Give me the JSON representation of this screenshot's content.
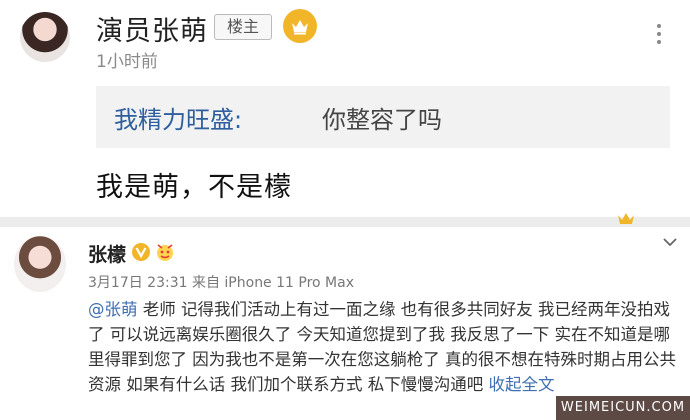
{
  "post": {
    "author": "演员张萌",
    "role_badge": "楼主",
    "time": "1小时前",
    "quote": {
      "user": "我精力旺盛:",
      "text": "你整容了吗"
    },
    "reply": "我是萌，不是檬"
  },
  "comment": {
    "author": "张檬",
    "meta": "3月17日 23:31 来自 iPhone 11 Pro Max",
    "mention": "@张萌",
    "body": " 老师  记得我们活动上有过一面之缘  也有很多共同好友  我已经两年没拍戏了  可以说远离娱乐圈很久了  今天知道您提到了我  我反思了一下  实在不知道是哪里得罪到您了  因为我也不是第一次在您这躺枪了   真的很不想在特殊时期占用公共资源  如果有什么话  我们加个联系方式  私下慢慢沟通吧 ",
    "fold_label": "收起全文"
  },
  "watermark": "WEIMEICUN.COM",
  "colors": {
    "link": "#3f6fb2",
    "quote_user": "#2f5f9e",
    "gold": "#f1b52a"
  },
  "icons": [
    "crown-badge-icon",
    "more-vertical-icon",
    "verified-v-icon",
    "fan-badge-icon",
    "chevron-down-icon"
  ]
}
